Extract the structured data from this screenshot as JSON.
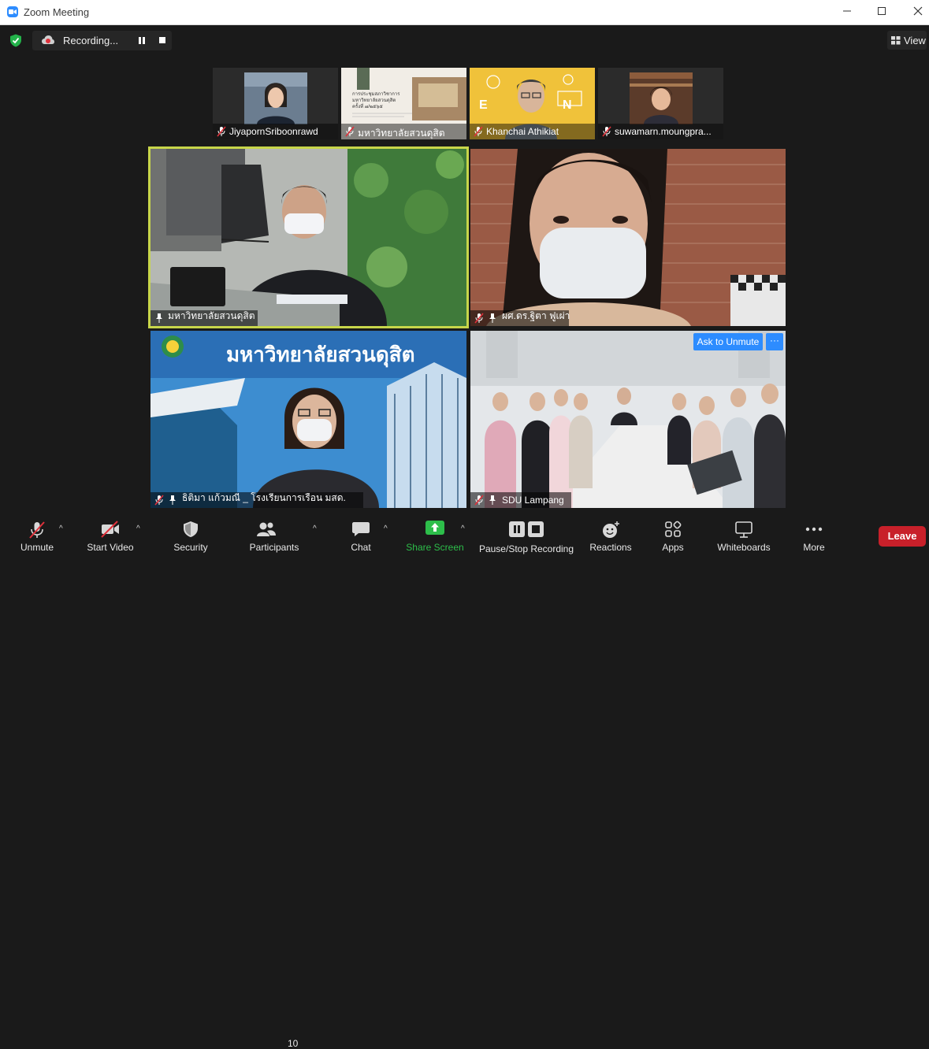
{
  "window": {
    "title": "Zoom Meeting"
  },
  "recording": {
    "label": "Recording..."
  },
  "view": {
    "label": "View"
  },
  "thumbnails": [
    {
      "name": "JiyapornSriboonrawd"
    },
    {
      "name": "มหาวิทยาลัยสวนดุสิต",
      "slide_lines": [
        "การประชุมสภาวิชาการ",
        "มหาวิทยาลัยสวนดุสิต",
        "ครั้งที่ ๗/๒๕๖๕"
      ]
    },
    {
      "name": "Khanchai Athikiat"
    },
    {
      "name": "suwamarn.moungpra..."
    }
  ],
  "tiles": [
    {
      "name": "มหาวิทยาลัยสวนดุสิต"
    },
    {
      "name": "ผศ.ดร.ฐิตา ฟูเผ่า"
    },
    {
      "name": "ธิติมา แก้วมณี _ โรงเรียนการเรือน มสด.",
      "banner": "มหาวิทยาลัยสวนดุสิต"
    },
    {
      "name": "SDU Lampang"
    }
  ],
  "ask_to_unmute": "Ask to Unmute",
  "more_options": "···",
  "toolbar": {
    "unmute": "Unmute",
    "start_video": "Start Video",
    "security": "Security",
    "participants": "Participants",
    "participants_count": "10",
    "chat": "Chat",
    "share_screen": "Share Screen",
    "pause_stop_recording": "Pause/Stop Recording",
    "reactions": "Reactions",
    "apps": "Apps",
    "whiteboards": "Whiteboards",
    "more": "More",
    "leave": "Leave"
  },
  "colors": {
    "accent_blue": "#2d8cff",
    "active_speaker": "#c8d64a",
    "leave_red": "#c8202a",
    "share_green": "#2dbe4a",
    "muted_red": "#e0313b"
  }
}
